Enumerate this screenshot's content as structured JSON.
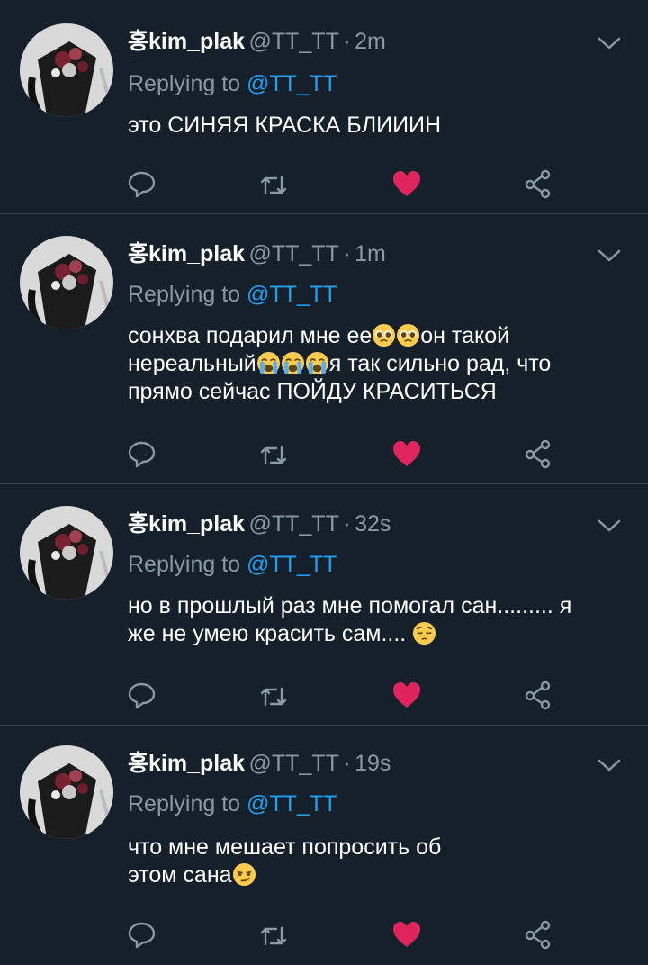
{
  "tweets": [
    {
      "name": "홍kim_plak",
      "handle": "@TT_TT",
      "dot": "·",
      "time": "2m",
      "replying_prefix": "Replying to ",
      "replying_mention": "@TT_TT",
      "text": "это СИНЯЯ КРАСКА БЛИИИН"
    },
    {
      "name": "홍kim_plak",
      "handle": "@TT_TT",
      "dot": "·",
      "time": "1m",
      "replying_prefix": "Replying to ",
      "replying_mention": "@TT_TT",
      "text_1": "сонхва подарил мне ее",
      "text_2": "он такой",
      "text_3": "нереальный",
      "text_4": "я так сильно рад, что",
      "text_5": "прямо сейчас ПОЙДУ КРАСИТЬСЯ",
      "emoji_1": "pleading-face-emoji",
      "emoji_2": "crying-face-emoji"
    },
    {
      "name": "홍kim_plak",
      "handle": "@TT_TT",
      "dot": "·",
      "time": "32s",
      "replying_prefix": "Replying to ",
      "replying_mention": "@TT_TT",
      "text_1": "но в прошлый раз мне помогал сан......... я",
      "text_2": "же не умею красить сам.... ",
      "emoji_1": "pensive-face-emoji"
    },
    {
      "name": "홍kim_plak",
      "handle": "@TT_TT",
      "dot": "·",
      "time": "19s",
      "replying_prefix": "Replying to ",
      "replying_mention": "@TT_TT",
      "text_1": "что мне мешает попросить об",
      "text_2": "этом сана",
      "emoji_1": "smirking-face-emoji"
    }
  ],
  "icons": {
    "reply": "reply-bubble-icon",
    "retweet": "retweet-icon",
    "like": "heart-icon",
    "share": "share-icon",
    "caret": "chevron-down-icon"
  },
  "colors": {
    "background": "#15202b",
    "text": "#ffffff",
    "secondary": "#8899a6",
    "link": "#1da1f2",
    "like": "#e0245e",
    "divider": "#38444d"
  }
}
